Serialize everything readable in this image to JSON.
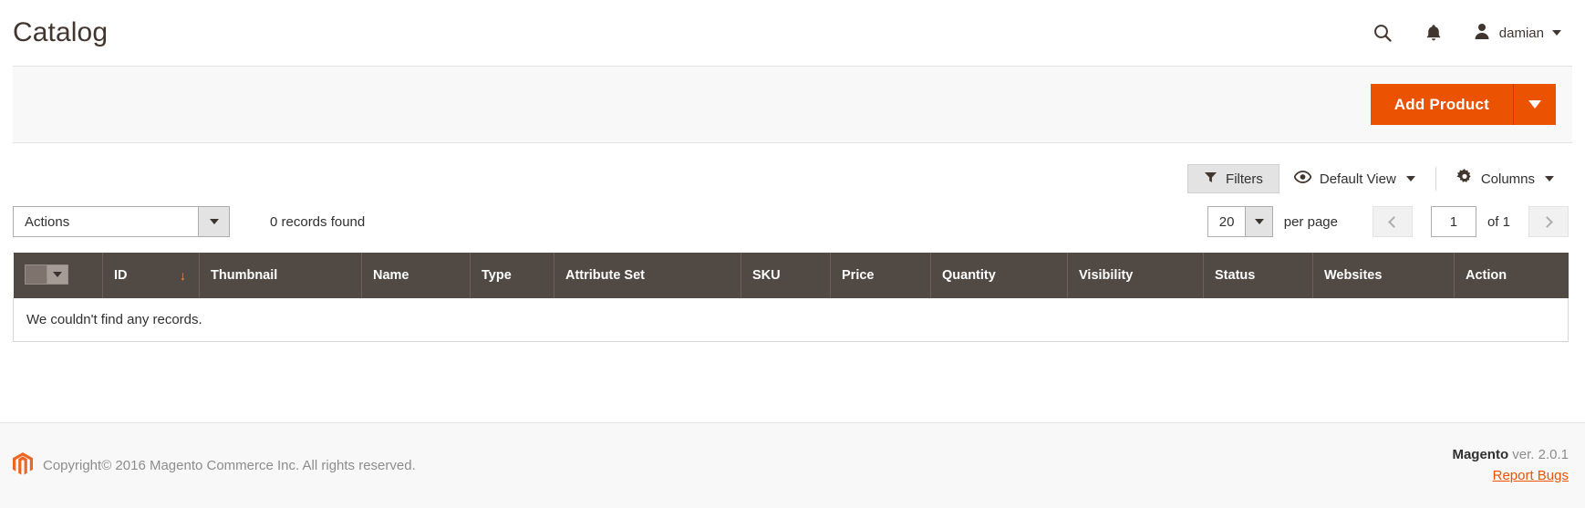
{
  "header": {
    "title": "Catalog",
    "search_icon": "search-icon",
    "notifications_icon": "bell-icon",
    "user": {
      "name": "damian",
      "avatar_icon": "user-avatar-icon",
      "caret_icon": "chevron-down-icon"
    }
  },
  "page_actions": {
    "add_product_label": "Add Product",
    "add_product_toggle_icon": "caret-down-icon",
    "accent_color": "#eb5202"
  },
  "toolbar": {
    "filters_label": "Filters",
    "filters_icon": "funnel-icon",
    "view_label": "Default View",
    "view_icon": "eye-icon",
    "view_caret_icon": "chevron-down-icon",
    "columns_label": "Columns",
    "columns_icon": "gear-icon",
    "columns_caret_icon": "chevron-down-icon"
  },
  "grid_controls": {
    "actions_label": "Actions",
    "actions_caret_icon": "caret-down-icon",
    "records_found": "0 records found",
    "per_page_value": "20",
    "per_page_caret_icon": "caret-down-icon",
    "per_page_label": "per page",
    "prev_icon": "chevron-left-icon",
    "next_icon": "chevron-right-icon",
    "current_page": "1",
    "of_pages_label": "of 1"
  },
  "grid": {
    "select_all_checkbox_icon": "checkbox-icon",
    "select_all_caret_icon": "caret-down-icon",
    "sort_indicator": "↓",
    "columns": [
      "ID",
      "Thumbnail",
      "Name",
      "Type",
      "Attribute Set",
      "SKU",
      "Price",
      "Quantity",
      "Visibility",
      "Status",
      "Websites",
      "Action"
    ],
    "rows": [],
    "empty_message": "We couldn't find any records."
  },
  "footer": {
    "logo_icon": "magento-logo-icon",
    "copyright": "Copyright© 2016 Magento Commerce Inc. All rights reserved.",
    "product_name": "Magento",
    "version": " ver. 2.0.1",
    "report_bugs_label": "Report Bugs",
    "link_color": "#eb5202"
  }
}
